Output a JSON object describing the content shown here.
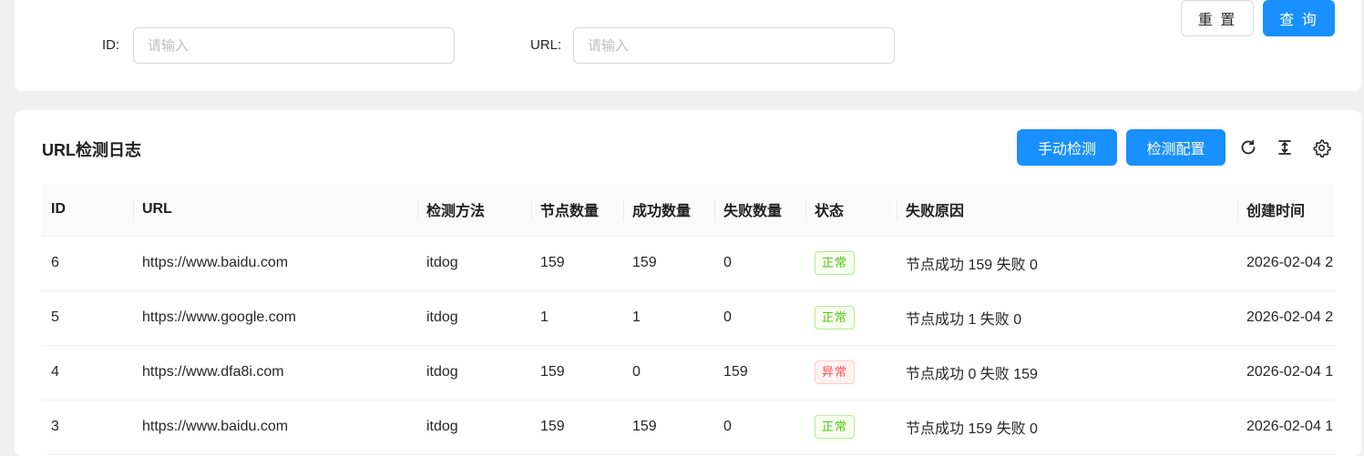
{
  "search": {
    "id_label": "ID:",
    "id_placeholder": "请输入",
    "url_label": "URL:",
    "url_placeholder": "请输入",
    "reset_label": "重 置",
    "query_label": "查 询"
  },
  "table_card": {
    "title": "URL检测日志",
    "manual_check_label": "手动检测",
    "check_config_label": "检测配置",
    "tool_icons": [
      "refresh-icon",
      "column-height-icon",
      "setting-icon"
    ]
  },
  "columns": [
    "ID",
    "URL",
    "检测方法",
    "节点数量",
    "成功数量",
    "失败数量",
    "状态",
    "失败原因",
    "创建时间"
  ],
  "rows": [
    {
      "id": "6",
      "url": "https://www.baidu.com",
      "method": "itdog",
      "nodes": "159",
      "success": "159",
      "fail": "0",
      "status": "正常",
      "status_type": "ok",
      "reason": "节点成功 159 失败 0",
      "created": "2026-02-04 2"
    },
    {
      "id": "5",
      "url": "https://www.google.com",
      "method": "itdog",
      "nodes": "1",
      "success": "1",
      "fail": "0",
      "status": "正常",
      "status_type": "ok",
      "reason": "节点成功 1 失败 0",
      "created": "2026-02-04 2"
    },
    {
      "id": "4",
      "url": "https://www.dfa8i.com",
      "method": "itdog",
      "nodes": "159",
      "success": "0",
      "fail": "159",
      "status": "异常",
      "status_type": "err",
      "reason": "节点成功 0 失败 159",
      "created": "2026-02-04 1"
    },
    {
      "id": "3",
      "url": "https://www.baidu.com",
      "method": "itdog",
      "nodes": "159",
      "success": "159",
      "fail": "0",
      "status": "正常",
      "status_type": "ok",
      "reason": "节点成功 159 失败 0",
      "created": "2026-02-04 1"
    }
  ],
  "colors": {
    "primary": "#1890ff",
    "ok": "#52c41a",
    "error": "#ff4d4f"
  }
}
